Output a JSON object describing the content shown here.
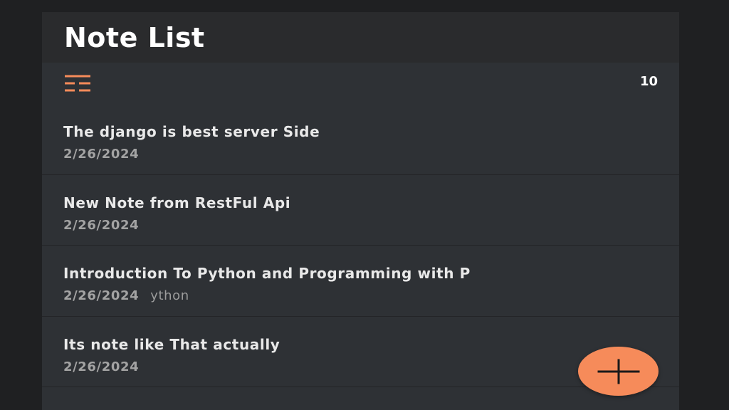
{
  "header": {
    "title": "Note List"
  },
  "toolbar": {
    "menu_icon": "list-menu-icon",
    "note_count": "10",
    "accent_color": "#f68b5a"
  },
  "notes": [
    {
      "title": "The django is best server Side",
      "date": "2/26/2024",
      "preview": ""
    },
    {
      "title": "New Note from RestFul Api",
      "date": "2/26/2024",
      "preview": ""
    },
    {
      "title": "Introduction To Python and Programming with P",
      "date": "2/26/2024",
      "preview": "ython"
    },
    {
      "title": "Its note like That actually",
      "date": "2/26/2024",
      "preview": ""
    }
  ],
  "fab": {
    "icon": "plus-icon",
    "color": "#f68b5a"
  }
}
